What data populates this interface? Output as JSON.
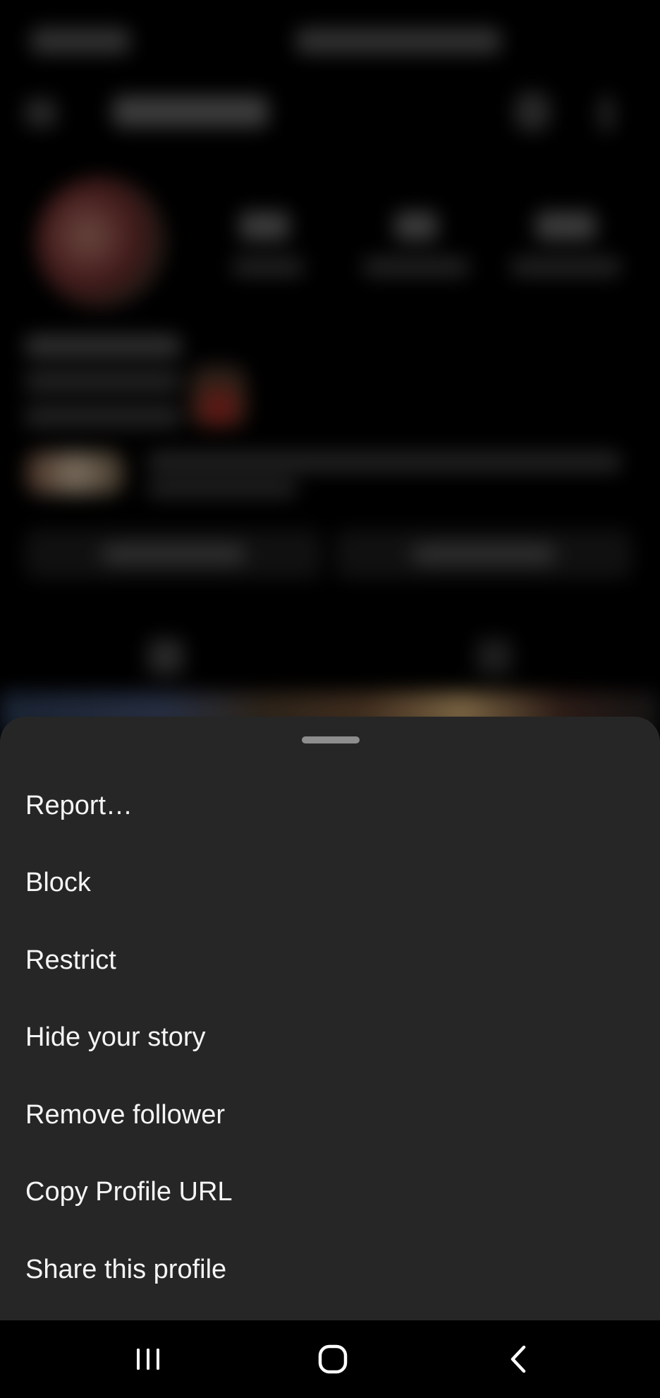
{
  "sheet": {
    "menu": [
      {
        "id": "report",
        "label": "Report…"
      },
      {
        "id": "block",
        "label": "Block"
      },
      {
        "id": "restrict",
        "label": "Restrict"
      },
      {
        "id": "hide-story",
        "label": "Hide your story"
      },
      {
        "id": "remove-follower",
        "label": "Remove follower"
      },
      {
        "id": "copy-url",
        "label": "Copy Profile URL"
      },
      {
        "id": "share-profile",
        "label": "Share this profile"
      }
    ]
  },
  "navbar": {
    "icons": [
      "recent-apps-icon",
      "home-icon",
      "back-icon"
    ]
  },
  "colors": {
    "sheet_bg": "#262626",
    "handle": "#8e8e8e",
    "text": "#f5f5f5",
    "navbar_bg": "#000000"
  }
}
